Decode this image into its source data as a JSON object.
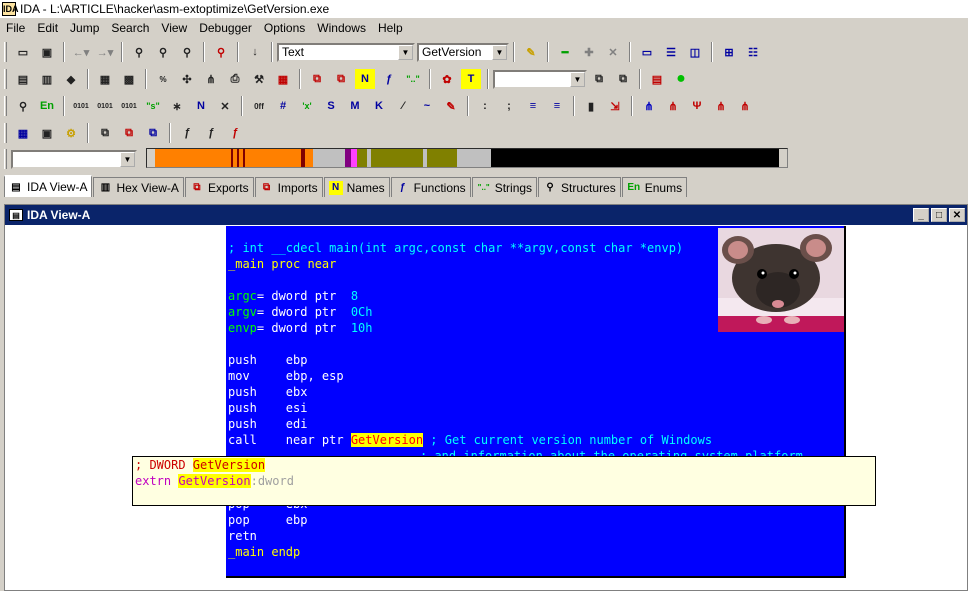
{
  "window": {
    "title": "IDA - L:\\ARTICLE\\hacker\\asm-extoptimize\\GetVersion.exe",
    "icon_text": "IDA"
  },
  "menu": [
    "File",
    "Edit",
    "Jump",
    "Search",
    "View",
    "Debugger",
    "Options",
    "Windows",
    "Help"
  ],
  "toolbar": {
    "segment_combo": "Text",
    "name_combo": "GetVersion",
    "find_combo": "",
    "nav_combo": ""
  },
  "tabs": [
    {
      "label": "IDA View-A",
      "icon": "ida-view-icon",
      "active": true
    },
    {
      "label": "Hex View-A",
      "icon": "hex-view-icon",
      "active": false
    },
    {
      "label": "Exports",
      "icon": "exports-icon",
      "active": false
    },
    {
      "label": "Imports",
      "icon": "imports-icon",
      "active": false
    },
    {
      "label": "Names",
      "icon": "names-icon",
      "active": false
    },
    {
      "label": "Functions",
      "icon": "functions-icon",
      "active": false
    },
    {
      "label": "Strings",
      "icon": "strings-icon",
      "active": false
    },
    {
      "label": "Structures",
      "icon": "structures-icon",
      "active": false
    },
    {
      "label": "Enums",
      "icon": "enums-icon",
      "active": false
    }
  ],
  "mdi": {
    "title": "IDA View-A"
  },
  "code": {
    "l1": "; int __cdecl main(int argc,const char **argv,const char *envp)",
    "main_label": "_main",
    "main_rest": " proc near",
    "argc_name": "argc",
    "argc_rest": "= dword ptr  ",
    "argc_val": "8",
    "argv_name": "argv",
    "argv_rest": "= dword ptr  ",
    "argv_val": "0Ch",
    "envp_name": "envp",
    "envp_rest": "= dword ptr  ",
    "envp_val": "10h",
    "i1": "push    ebp",
    "i2": "mov     ebp, esp",
    "i3": "push    ebx",
    "i4": "push    esi",
    "i5": "push    edi",
    "call_pre": "call    near ptr ",
    "call_target": "GetVersion",
    "call_comment": " ; Get current version number of Windows",
    "call_comment2": "; and information about the operating system platform",
    "i6": "pop     ebx",
    "i7": "pop     ebp",
    "i8": "retn",
    "endp_label": "_main",
    "endp_rest": " endp"
  },
  "hint": {
    "line1_pre": "; DWORD ",
    "line1_name": "GetVersion",
    "line2_pre": "extrn ",
    "line2_name": "GetVersion",
    "line2_post": ":dword"
  },
  "colors": {
    "code_bg": "#0000ff",
    "title_active": "#0a246a"
  }
}
